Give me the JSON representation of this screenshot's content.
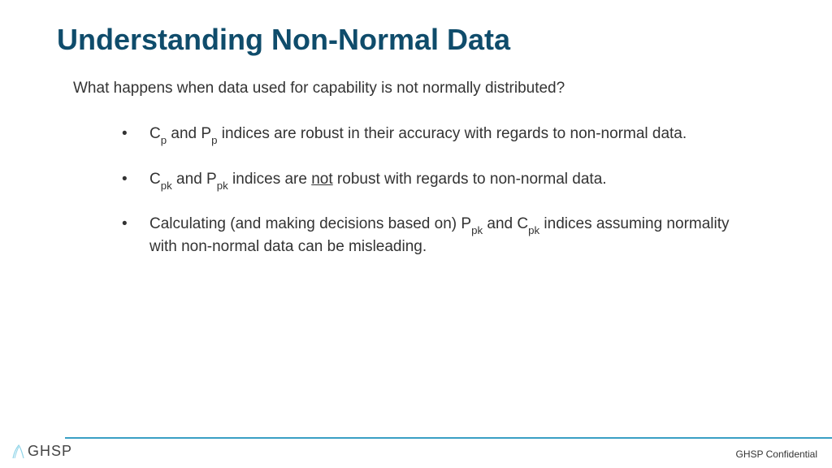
{
  "title": "Understanding Non-Normal Data",
  "intro": "What happens when data used for capability is not normally distributed?",
  "bullets": {
    "b1_pre": "C",
    "b1_sub1": "p",
    "b1_mid1": " and P",
    "b1_sub2": "p",
    "b1_post": " indices are robust in their accuracy with regards to non-normal data.",
    "b2_pre": "C",
    "b2_sub1": "pk",
    "b2_mid1": " and P",
    "b2_sub2": "pk",
    "b2_mid2": " indices are ",
    "b2_not": "not",
    "b2_post": " robust with regards to non-normal data.",
    "b3_pre": "Calculating (and making decisions based on) P",
    "b3_sub1": "pk",
    "b3_mid1": " and C",
    "b3_sub2": "pk",
    "b3_post": " indices assuming normality with non-normal data can be misleading."
  },
  "footer": {
    "logo_text": "GHSP",
    "confidential": "GHSP Confidential"
  }
}
